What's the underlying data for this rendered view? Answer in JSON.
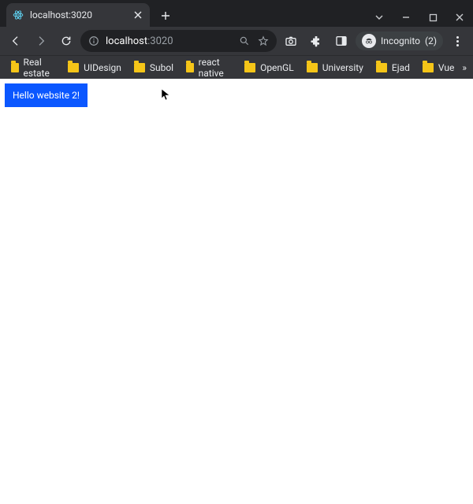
{
  "tab": {
    "title": "localhost:3020"
  },
  "url": {
    "host": "localhost",
    "port": ":3020"
  },
  "incognito": {
    "label": "Incognito",
    "count": "(2)"
  },
  "bookmarks": {
    "items": [
      {
        "label": "Real estate"
      },
      {
        "label": "UIDesign"
      },
      {
        "label": "Subol"
      },
      {
        "label": "react native"
      },
      {
        "label": "OpenGL"
      },
      {
        "label": "University"
      },
      {
        "label": "Ejad"
      },
      {
        "label": "Vue"
      }
    ],
    "overflow": "»"
  },
  "page": {
    "button_label": "Hello website 2!"
  }
}
